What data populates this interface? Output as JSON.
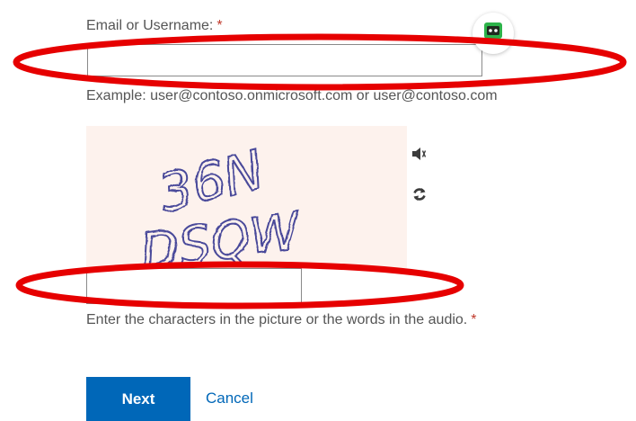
{
  "form": {
    "email_label": "Email or Username:",
    "required_marker": "*",
    "email_value": "",
    "example_text": "Example: user@contoso.onmicrosoft.com or user@contoso.com",
    "captcha_text": "36N DSQW",
    "captcha_line1": "36N",
    "captcha_line2": "DSQW",
    "captcha_value": "",
    "captcha_hint": "Enter the characters in the picture or the words in the audio.",
    "next_label": "Next",
    "cancel_label": "Cancel"
  },
  "icons": {
    "password_manager": "password-manager-icon",
    "audio": "speaker-icon",
    "refresh": "refresh-icon"
  },
  "colors": {
    "accent": "#0067b8",
    "required": "#c0392b",
    "annotation": "#e60000",
    "captcha_bg": "#fdf2ed",
    "captcha_ink": "#4a4a9a",
    "password_manager": "#2db34a"
  }
}
